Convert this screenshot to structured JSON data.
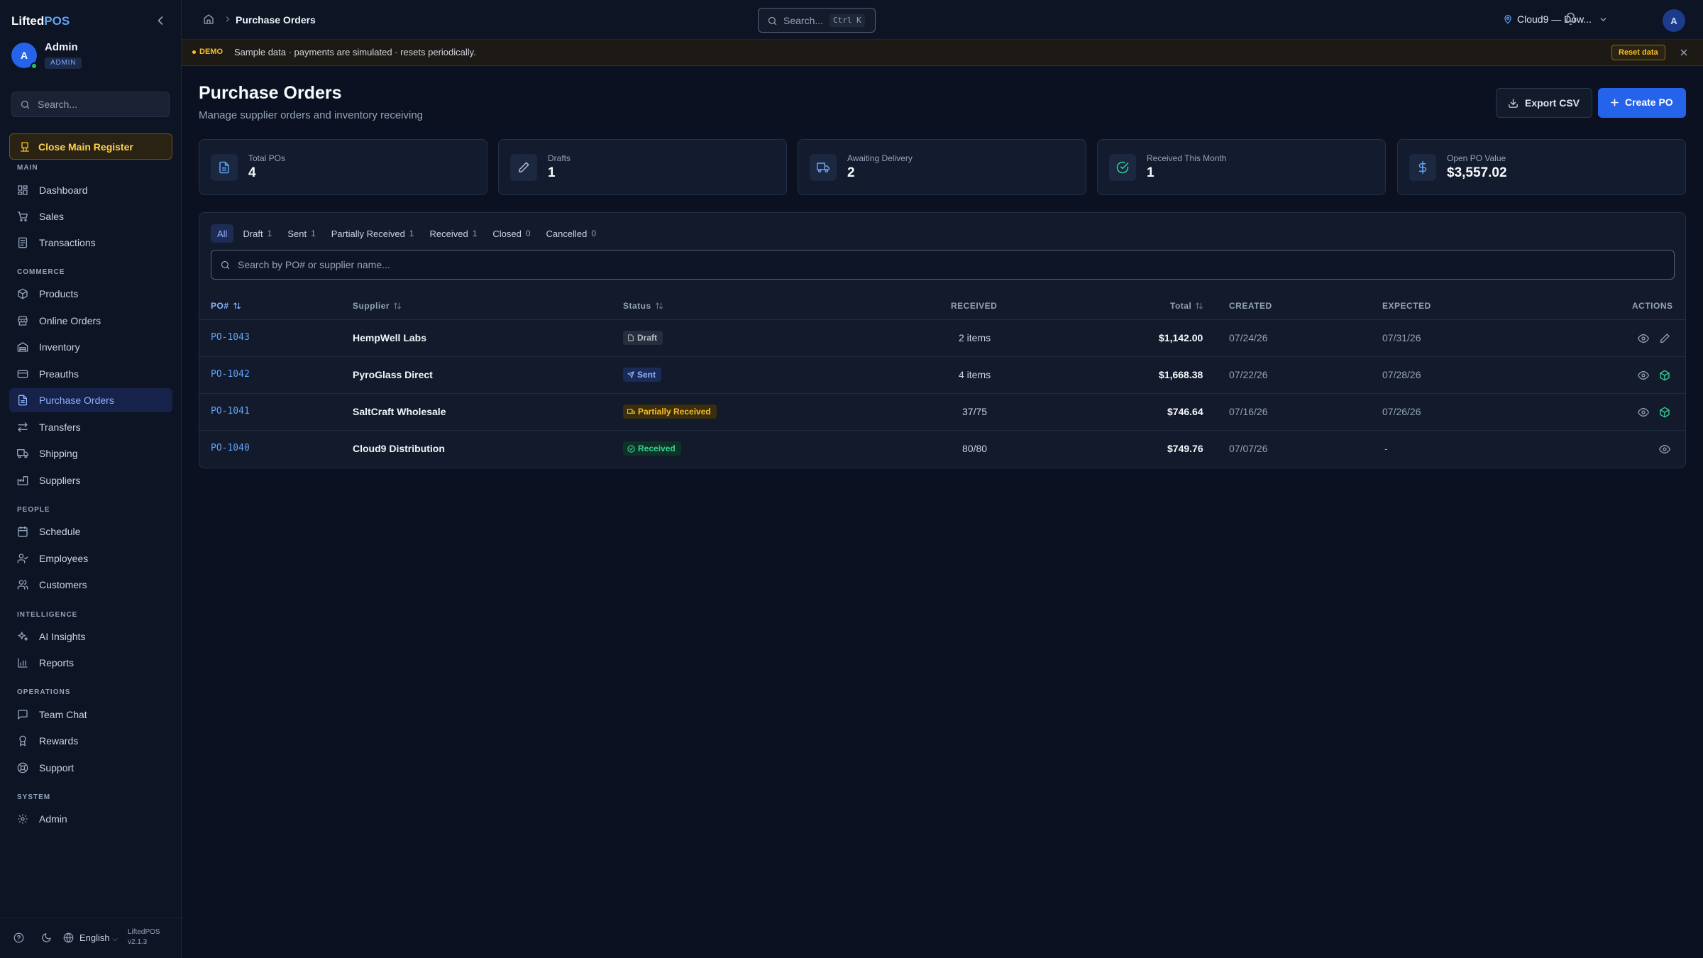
{
  "app": {
    "brand_prefix": "Lifted",
    "brand_suffix": "POS"
  },
  "user": {
    "initial": "A",
    "name": "Admin",
    "role": "ADMIN"
  },
  "sidebar": {
    "search_placeholder": "Search...",
    "close_register": "Close Main Register",
    "sections": {
      "main": "MAIN",
      "commerce": "COMMERCE",
      "people": "PEOPLE",
      "intelligence": "INTELLIGENCE",
      "operations": "OPERATIONS",
      "system": "SYSTEM"
    },
    "items": {
      "dashboard": "Dashboard",
      "sales": "Sales",
      "transactions": "Transactions",
      "products": "Products",
      "online_orders": "Online Orders",
      "inventory": "Inventory",
      "preauths": "Preauths",
      "purchase_orders": "Purchase Orders",
      "transfers": "Transfers",
      "shipping": "Shipping",
      "suppliers": "Suppliers",
      "schedule": "Schedule",
      "employees": "Employees",
      "customers": "Customers",
      "ai_insights": "AI Insights",
      "reports": "Reports",
      "team_chat": "Team Chat",
      "rewards": "Rewards",
      "support": "Support",
      "admin": "Admin"
    },
    "active": "purchase_orders",
    "footer": {
      "language": "English",
      "app_name": "LiftedPOS",
      "version": "v2.1.3"
    }
  },
  "topbar": {
    "breadcrumb_current": "Purchase Orders",
    "search_placeholder": "Search...",
    "search_shortcut": "Ctrl K",
    "location": "Cloud9 — Dow...",
    "avatar_initial": "A"
  },
  "banner": {
    "tag": "DEMO",
    "message": "Sample data · payments are simulated · resets periodically.",
    "reset_label": "Reset data"
  },
  "page": {
    "title": "Purchase Orders",
    "subtitle": "Manage supplier orders and inventory receiving",
    "export_label": "Export CSV",
    "create_label": "Create PO"
  },
  "stats": [
    {
      "label": "Total POs",
      "value": "4",
      "icon": "file-icon"
    },
    {
      "label": "Drafts",
      "value": "1",
      "icon": "pencil-icon"
    },
    {
      "label": "Awaiting Delivery",
      "value": "2",
      "icon": "truck-icon"
    },
    {
      "label": "Received This Month",
      "value": "1",
      "icon": "check-circle-icon"
    },
    {
      "label": "Open PO Value",
      "value": "$3,557.02",
      "icon": "dollar-icon"
    }
  ],
  "filters": {
    "tabs": [
      {
        "label": "All",
        "count": ""
      },
      {
        "label": "Draft",
        "count": "1"
      },
      {
        "label": "Sent",
        "count": "1"
      },
      {
        "label": "Partially Received",
        "count": "1"
      },
      {
        "label": "Received",
        "count": "1"
      },
      {
        "label": "Closed",
        "count": "0"
      },
      {
        "label": "Cancelled",
        "count": "0"
      }
    ],
    "active_tab": "All",
    "search_placeholder": "Search by PO# or supplier name..."
  },
  "table": {
    "columns": {
      "po": "PO#",
      "supplier": "Supplier",
      "status": "Status",
      "received": "RECEIVED",
      "total": "Total",
      "created": "CREATED",
      "expected": "EXPECTED",
      "actions": "ACTIONS"
    },
    "rows": [
      {
        "po": "PO-1043",
        "supplier": "HempWell Labs",
        "status": "Draft",
        "received": "2 items",
        "total": "$1,142.00",
        "created": "07/24/26",
        "expected": "07/31/26"
      },
      {
        "po": "PO-1042",
        "supplier": "PyroGlass Direct",
        "status": "Sent",
        "received": "4 items",
        "total": "$1,668.38",
        "created": "07/22/26",
        "expected": "07/28/26"
      },
      {
        "po": "PO-1041",
        "supplier": "SaltCraft Wholesale",
        "status": "Partially Received",
        "received": "37/75",
        "total": "$746.64",
        "created": "07/16/26",
        "expected": "07/26/26"
      },
      {
        "po": "PO-1040",
        "supplier": "Cloud9 Distribution",
        "status": "Received",
        "received": "80/80",
        "total": "$749.76",
        "created": "07/07/26",
        "expected": "-"
      }
    ]
  },
  "colors": {
    "background": "#0b1120",
    "accent": "#2563eb",
    "draft": "#b6bdc9",
    "sent": "#8fb4ff",
    "partial": "#fbbf24",
    "received": "#34d399"
  }
}
